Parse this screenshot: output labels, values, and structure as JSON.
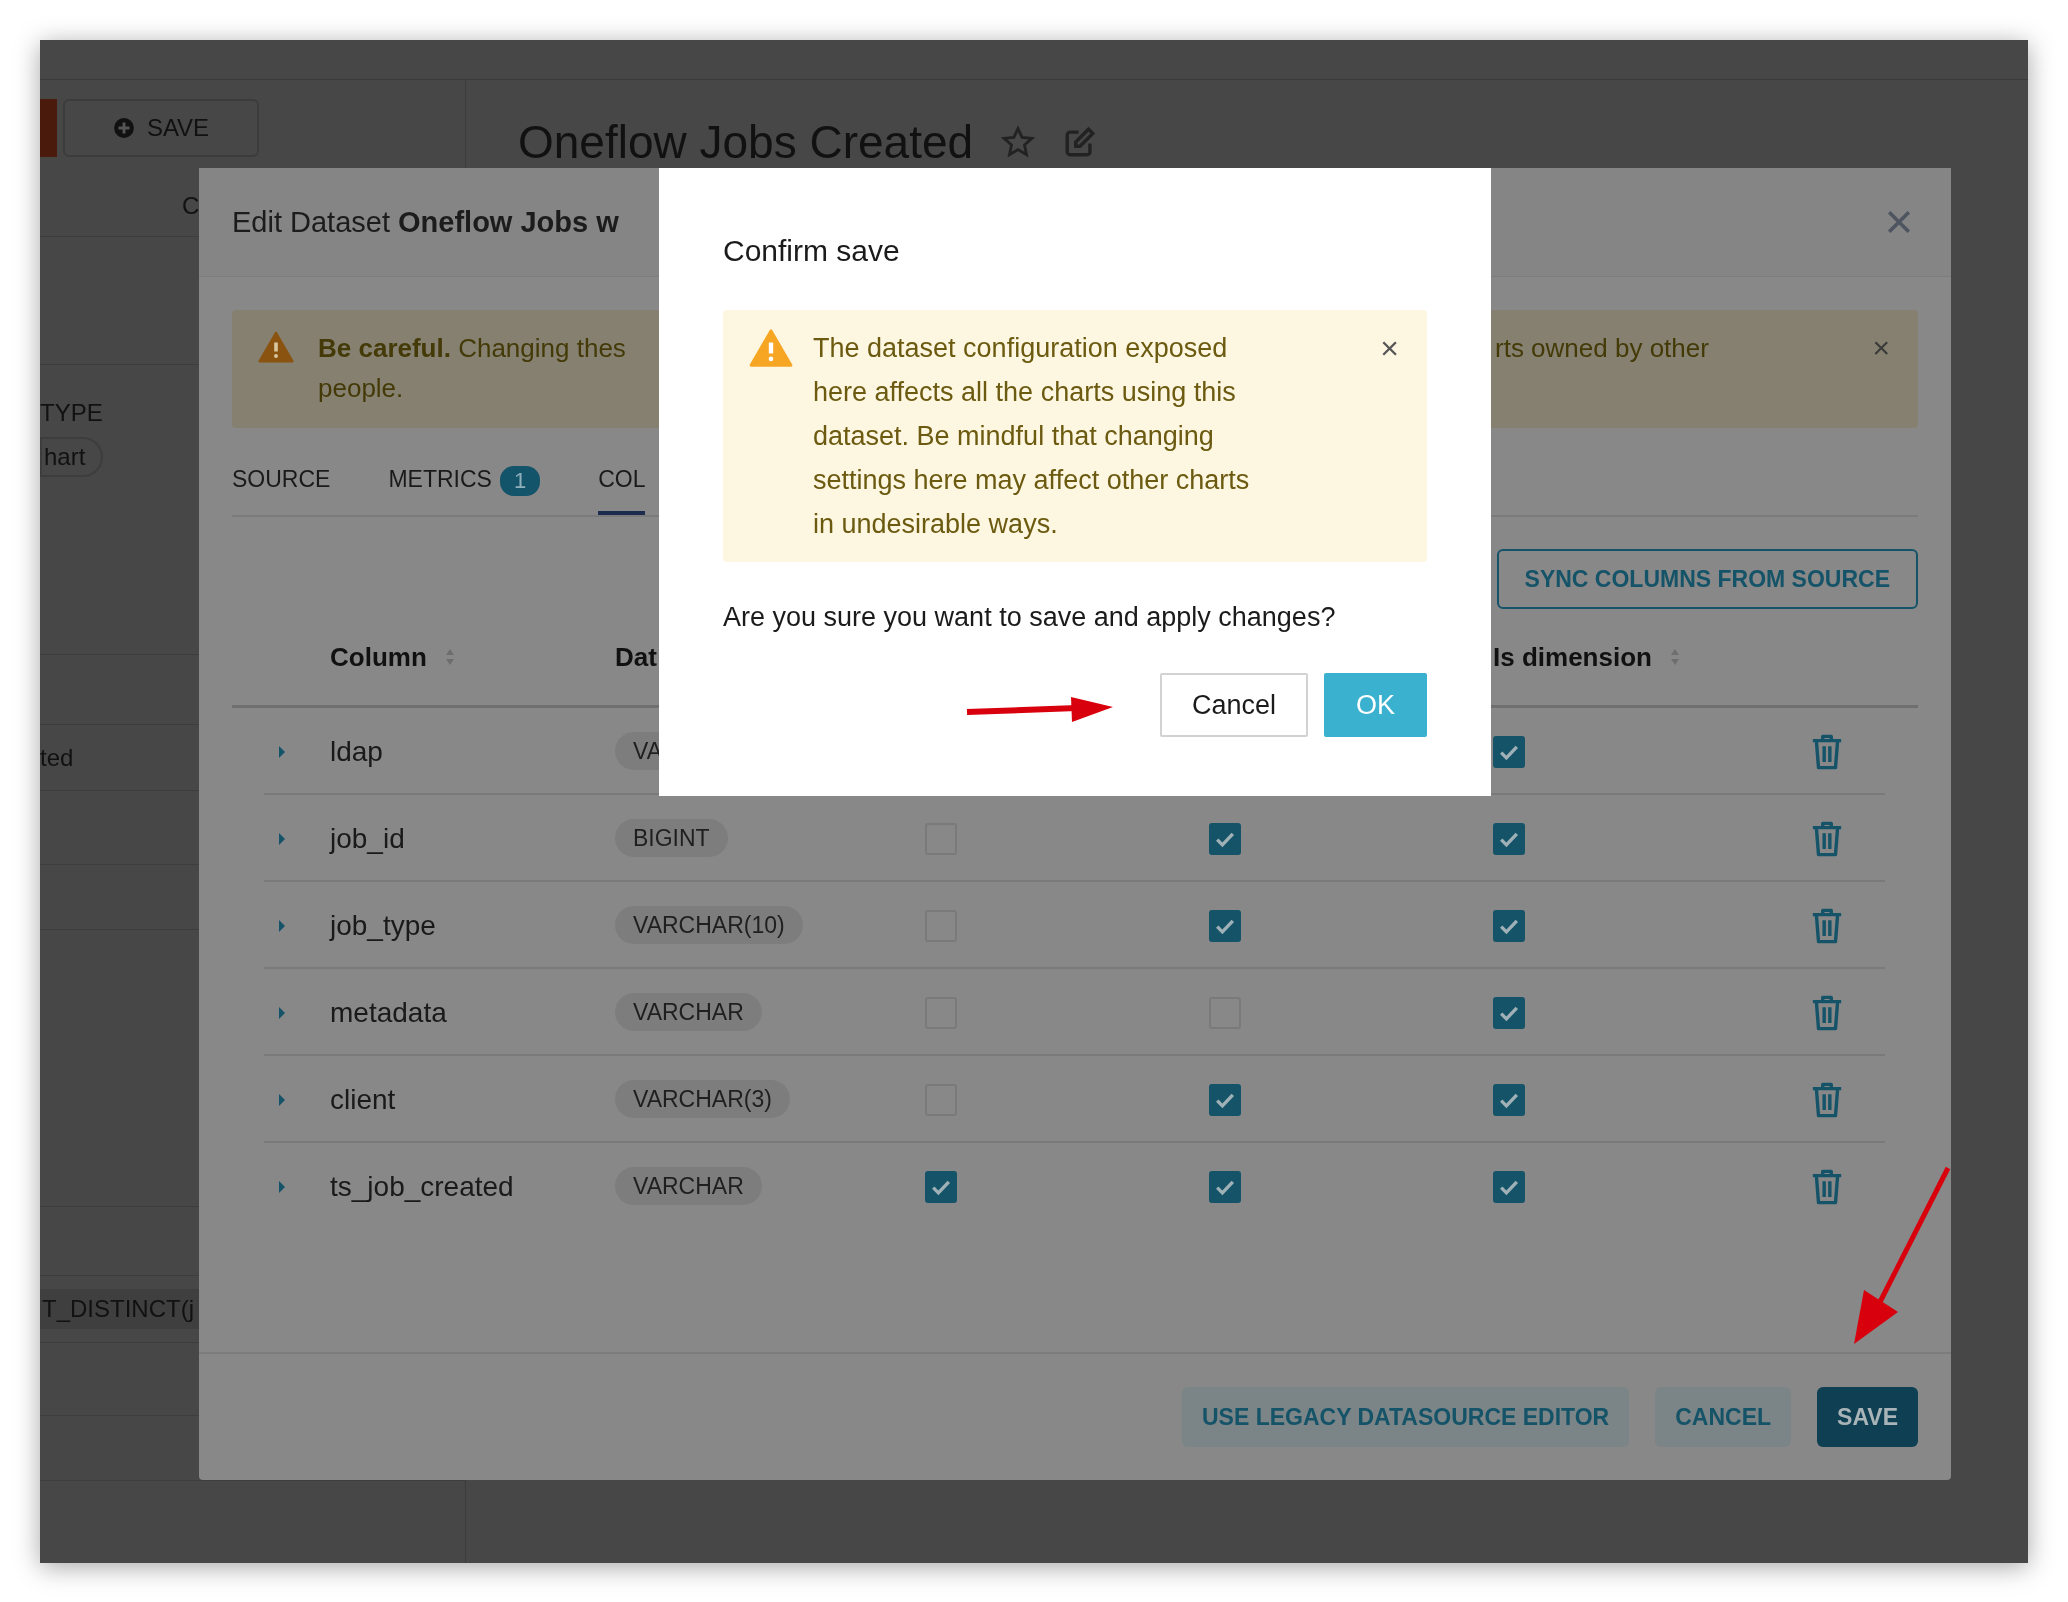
{
  "background": {
    "save_button": "SAVE",
    "tab_partial": "C",
    "type_label": "TYPE",
    "type_value": "hart",
    "list_item": "ted",
    "metric_pill": "T_DISTINCT(j",
    "chart_title": "Oneflow Jobs Created"
  },
  "edit_dataset": {
    "title": "Edit Dataset **Oneflow Jobs w**",
    "alert": {
      "lines_left": [
        "**Be careful.** Changing thes",
        "people."
      ],
      "text_right": "rts owned by other",
      "close": "×"
    },
    "tabs": [
      {
        "label": "SOURCE",
        "selected": false
      },
      {
        "label": "METRICS",
        "badge": "1",
        "selected": false
      },
      {
        "label": "COL",
        "selected": true
      }
    ],
    "sync_button": "SYNC COLUMNS FROM SOURCE",
    "columns": [
      "Column",
      "Dat",
      "Is dimension"
    ],
    "rows": [
      {
        "name": "ldap",
        "type": "VA",
        "is_dimension_checked": true
      },
      {
        "name": "job_id",
        "type": "BIGINT",
        "column_3_checked": false,
        "column_4_checked": true,
        "is_dimension_checked": true
      },
      {
        "name": "job_type",
        "type": "VARCHAR(10)",
        "column_3_checked": false,
        "column_4_checked": true,
        "is_dimension_checked": true
      },
      {
        "name": "metadata",
        "type": "VARCHAR",
        "column_3_checked": false,
        "column_4_checked": false,
        "is_dimension_checked": true
      },
      {
        "name": "client",
        "type": "VARCHAR(3)",
        "column_3_checked": false,
        "column_4_checked": true,
        "is_dimension_checked": true
      },
      {
        "name": "ts_job_created",
        "type": "VARCHAR",
        "column_3_checked": true,
        "column_4_checked": true,
        "is_dimension_checked": true
      }
    ],
    "footer_buttons": [
      {
        "label": "USE LEGACY DATASOURCE EDITOR",
        "kind": "secondary"
      },
      {
        "label": "CANCEL",
        "kind": "secondary"
      },
      {
        "label": "SAVE",
        "kind": "primary"
      }
    ]
  },
  "confirm": {
    "title": "Confirm save",
    "alert": "The dataset configuration exposed here affects all the charts using this dataset. Be mindful that changing settings here may affect other charts in undesirable ways.",
    "alert_close": "×",
    "question": "Are you sure you want to save and apply changes?",
    "buttons": [
      {
        "label": "Cancel",
        "kind": "default"
      },
      {
        "label": "OK",
        "kind": "primary"
      }
    ]
  }
}
